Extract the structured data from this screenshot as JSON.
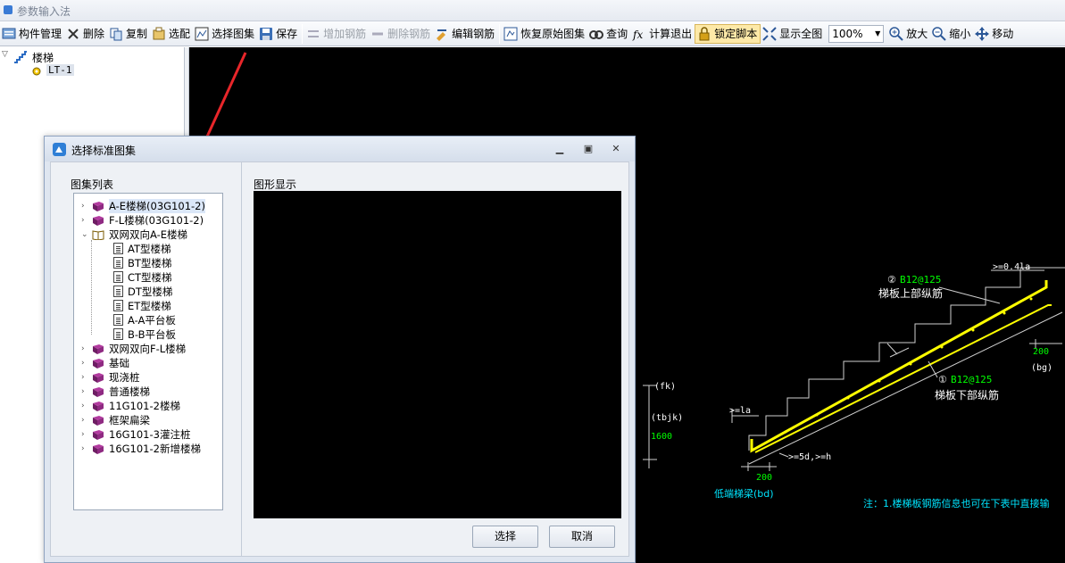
{
  "window": {
    "title": "参数输入法"
  },
  "toolbar": {
    "items": [
      {
        "label": "构件管理",
        "icon": "component-manage-icon"
      },
      {
        "label": "删除",
        "icon": "delete-x-icon"
      },
      {
        "label": "复制",
        "icon": "copy-icon"
      },
      {
        "label": "选配",
        "icon": "select-match-icon"
      },
      {
        "label": "选择图集",
        "icon": "atlas-select-icon"
      },
      {
        "label": "保存",
        "icon": "save-icon"
      },
      {
        "label": "增加钢筋",
        "icon": "add-rebar-icon",
        "disabled": true
      },
      {
        "label": "删除钢筋",
        "icon": "delete-rebar-icon",
        "disabled": true
      },
      {
        "label": "编辑钢筋",
        "icon": "edit-rebar-icon"
      },
      {
        "label": "恢复原始图集",
        "icon": "restore-atlas-icon"
      },
      {
        "label": "查询",
        "icon": "query-icon"
      },
      {
        "label": "计算退出",
        "icon": "calc-exit-icon"
      },
      {
        "label": "锁定脚本",
        "icon": "lock-icon"
      },
      {
        "label": "显示全图",
        "icon": "fit-all-icon"
      },
      {
        "label": "放大",
        "icon": "zoom-in-icon"
      },
      {
        "label": "缩小",
        "icon": "zoom-out-icon"
      },
      {
        "label": "移动",
        "icon": "move-icon"
      }
    ],
    "zoom": "100%"
  },
  "left_tree": {
    "root": "楼梯",
    "child": "LT-1"
  },
  "canvas": {
    "label_top_rebar_num": "②",
    "label_top_rebar": "B12@125",
    "label_top_rebar_name": "梯板上部纵筋",
    "label_bot_rebar_num": "①",
    "label_bot_rebar": "B12@125",
    "label_bot_rebar_name": "梯板下部纵筋",
    "label_04la": ">=0.4la",
    "label_200_right": "200",
    "label_bg": "(bg)",
    "label_fk": "(fk)",
    "label_tbjk": "(tbjk)",
    "label_1600": "1600",
    "label_la": ">=la",
    "label_5d": ">=5d,>=h",
    "label_200_left": "200",
    "label_bd": "低端梯梁(bd)",
    "note": "注：1.楼梯板钢筋信息也可在下表中直接输"
  },
  "dialog": {
    "title": "选择标准图集",
    "list_label": "图集列表",
    "preview_label": "图形显示",
    "tree": [
      {
        "label": "A-E楼梯(03G101-2)",
        "expanded": false,
        "selected": true
      },
      {
        "label": "F-L楼梯(03G101-2)",
        "expanded": false
      },
      {
        "label": "双网双向A-E楼梯",
        "expanded": true,
        "children": [
          "AT型楼梯",
          "BT型楼梯",
          "CT型楼梯",
          "DT型楼梯",
          "ET型楼梯",
          "A-A平台板",
          "B-B平台板"
        ]
      },
      {
        "label": "双网双向F-L楼梯",
        "expanded": false
      },
      {
        "label": "基础",
        "expanded": false
      },
      {
        "label": "现浇桩",
        "expanded": false
      },
      {
        "label": "普通楼梯",
        "expanded": false
      },
      {
        "label": "11G101-2楼梯",
        "expanded": false
      },
      {
        "label": "框架扁梁",
        "expanded": false
      },
      {
        "label": "16G101-3灌注桩",
        "expanded": false
      },
      {
        "label": "16G101-2新增楼梯",
        "expanded": false
      }
    ],
    "buttons": {
      "ok": "选择",
      "cancel": "取消"
    }
  },
  "colors": {
    "annotation_arrow": "#e8262a",
    "rebar": "#ffff00",
    "dim_green": "#00ff00",
    "note_cyan": "#00e5ff"
  }
}
